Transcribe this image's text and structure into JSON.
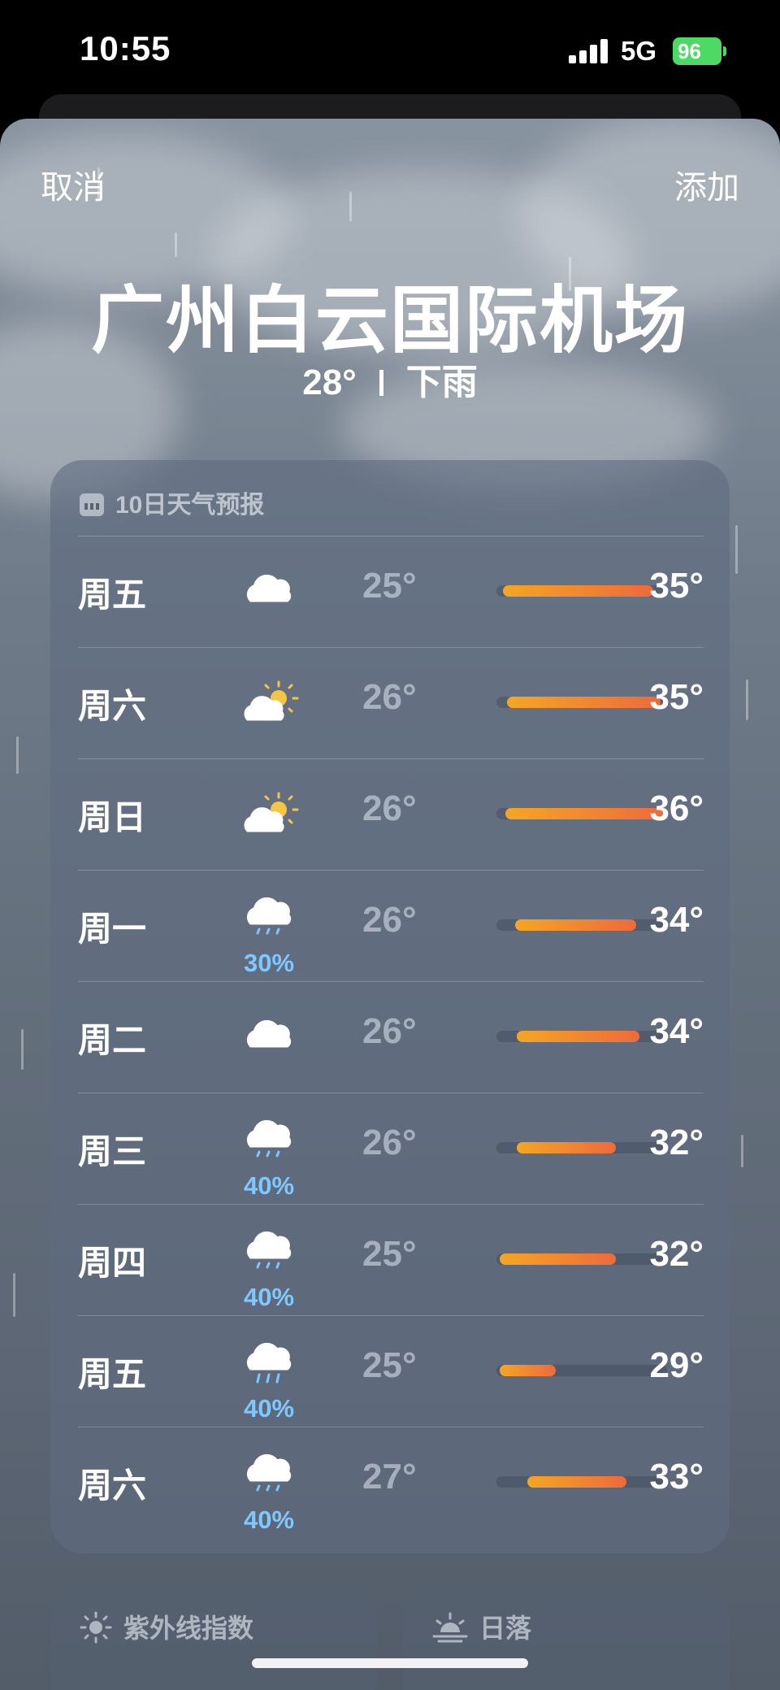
{
  "status_bar": {
    "time": "10:55",
    "network": "5G",
    "battery": "96"
  },
  "header": {
    "cancel_label": "取消",
    "add_label": "添加"
  },
  "location": {
    "name": "广州白云国际机场",
    "temperature": "28°",
    "condition": "下雨"
  },
  "forecast": {
    "title": "10日天气预报",
    "days": [
      {
        "day": "周五",
        "icon": "cloud-icon",
        "precip": "",
        "low": "25°",
        "high": "35°",
        "range": [
          0.04,
          0.92
        ]
      },
      {
        "day": "周六",
        "icon": "partly-sunny-icon",
        "precip": "",
        "low": "26°",
        "high": "35°",
        "range": [
          0.06,
          0.96
        ]
      },
      {
        "day": "周日",
        "icon": "partly-sunny-icon",
        "precip": "",
        "low": "26°",
        "high": "36°",
        "range": [
          0.05,
          1.0
        ]
      },
      {
        "day": "周一",
        "icon": "cloud-drizzle-icon",
        "precip": "30%",
        "low": "26°",
        "high": "34°",
        "range": [
          0.11,
          0.82
        ]
      },
      {
        "day": "周二",
        "icon": "cloud-icon",
        "precip": "",
        "low": "26°",
        "high": "34°",
        "range": [
          0.12,
          0.84
        ]
      },
      {
        "day": "周三",
        "icon": "cloud-drizzle-icon",
        "precip": "40%",
        "low": "26°",
        "high": "32°",
        "range": [
          0.12,
          0.7
        ]
      },
      {
        "day": "周四",
        "icon": "cloud-drizzle-icon",
        "precip": "40%",
        "low": "25°",
        "high": "32°",
        "range": [
          0.02,
          0.7
        ]
      },
      {
        "day": "周五",
        "icon": "cloud-rain-icon",
        "precip": "40%",
        "low": "25°",
        "high": "29°",
        "range": [
          0.02,
          0.35
        ]
      },
      {
        "day": "周六",
        "icon": "cloud-drizzle-icon",
        "precip": "40%",
        "low": "27°",
        "high": "33°",
        "range": [
          0.18,
          0.76
        ]
      }
    ]
  },
  "uv_card": {
    "title": "紫外线指数",
    "icon": "sun-icon"
  },
  "sunset_card": {
    "title": "日落",
    "icon": "sunset-icon"
  },
  "colors": {
    "bar_cool": "#f5a623",
    "bar_warm": "#ee6a3b",
    "precip": "#7fc8ff",
    "battery": "#4cd964"
  }
}
